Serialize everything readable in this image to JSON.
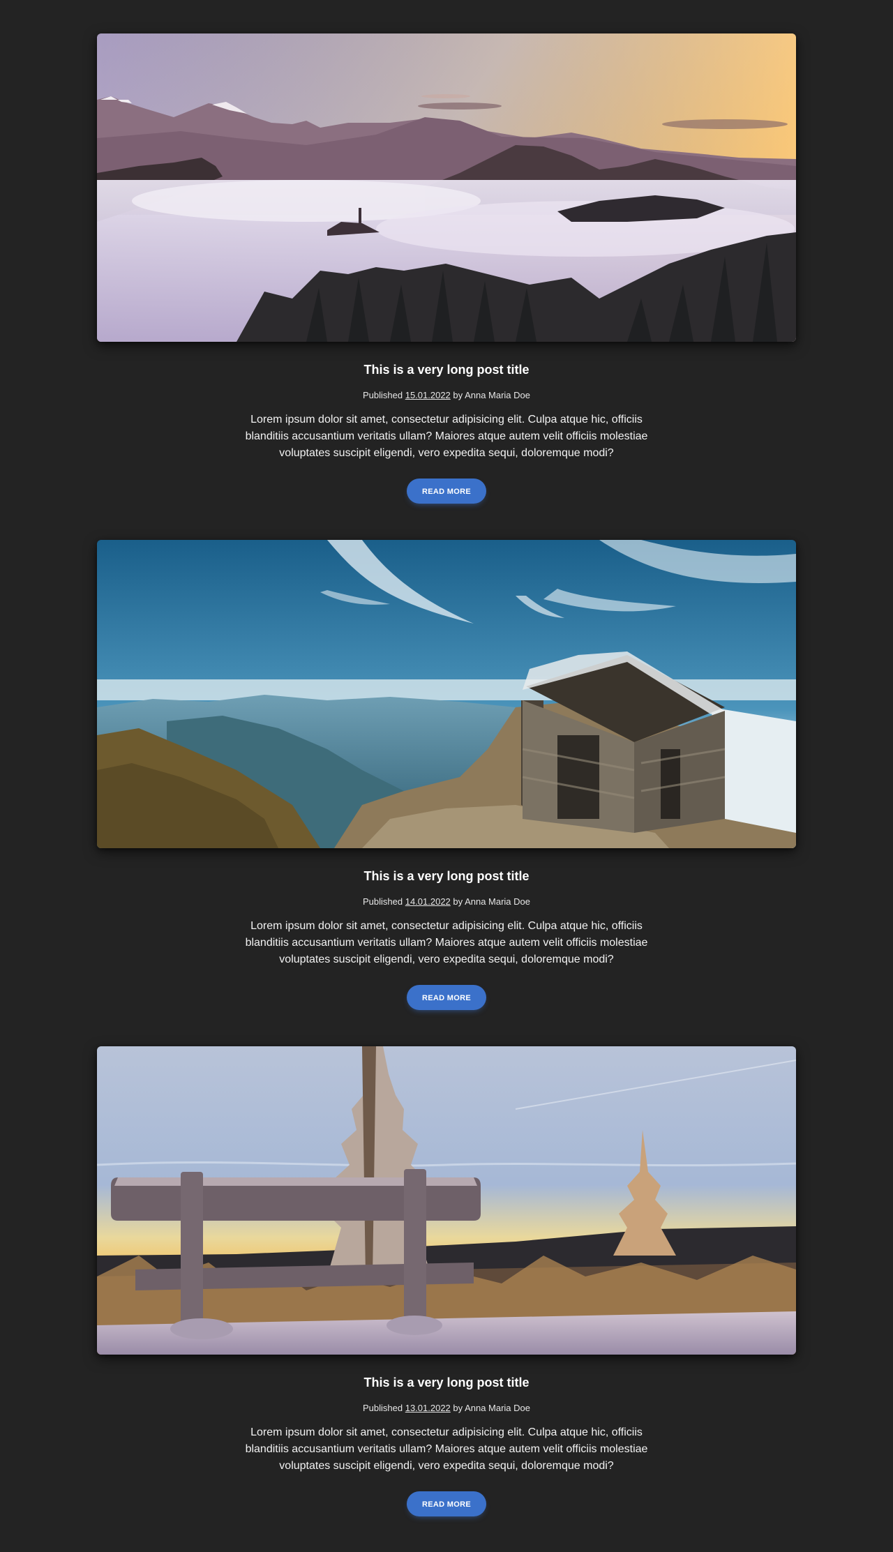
{
  "posts": [
    {
      "image": "image-foggy-mountain-valley",
      "title": "This is a very long post title",
      "published_label": "Published",
      "date": "15.01.2022",
      "by_label": "by",
      "author": "Anna Maria Doe",
      "excerpt": "Lorem ipsum dolor sit amet, consectetur adipisicing elit. Culpa atque hic, officiis blanditiis accusantium veritatis ullam? Maiores atque autem velit officiis molestiae voluptates suscipit eligendi, vero expedita sequi, doloremque modi?",
      "button_label": "Read more"
    },
    {
      "image": "image-stone-hut-mountains",
      "title": "This is a very long post title",
      "published_label": "Published",
      "date": "14.01.2022",
      "by_label": "by",
      "author": "Anna Maria Doe",
      "excerpt": "Lorem ipsum dolor sit amet, consectetur adipisicing elit. Culpa atque hic, officiis blanditiis accusantium veritatis ullam? Maiores atque autem velit officiis molestiae voluptates suscipit eligendi, vero expedita sequi, doloremque modi?",
      "button_label": "Read more"
    },
    {
      "image": "image-frozen-bench-sunset",
      "title": "This is a very long post title",
      "published_label": "Published",
      "date": "13.01.2022",
      "by_label": "by",
      "author": "Anna Maria Doe",
      "excerpt": "Lorem ipsum dolor sit amet, consectetur adipisicing elit. Culpa atque hic, officiis blanditiis accusantium veritatis ullam? Maiores atque autem velit officiis molestiae voluptates suscipit eligendi, vero expedita sequi, doloremque modi?",
      "button_label": "Read more"
    }
  ],
  "colors": {
    "background": "#232323",
    "button": "#3b71ca",
    "text": "#ffffff"
  }
}
